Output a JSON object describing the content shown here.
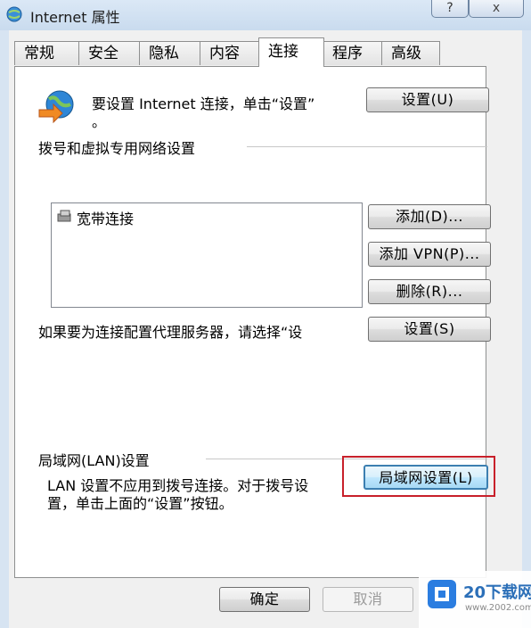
{
  "window": {
    "title": "Internet 属性",
    "help_btn": "?",
    "close_btn": "x"
  },
  "tabs": [
    {
      "label": "常规",
      "active": false
    },
    {
      "label": "安全",
      "active": false
    },
    {
      "label": "隐私",
      "active": false
    },
    {
      "label": "内容",
      "active": false
    },
    {
      "label": "连接",
      "active": true
    },
    {
      "label": "程序",
      "active": false
    },
    {
      "label": "高级",
      "active": false
    }
  ],
  "setup": {
    "text_line1": "要设置 Internet 连接，单击“设置”",
    "text_line2": "。",
    "button": "设置(U)"
  },
  "dialup": {
    "heading": "拨号和虚拟专用网络设置",
    "connections": [
      "宽带连接"
    ],
    "add_button": "添加(D)...",
    "add_vpn_button": "添加 VPN(P)...",
    "remove_button": "删除(R)...",
    "proxy_text": "如果要为连接配置代理服务器，请选择“设",
    "settings_button": "设置(S)"
  },
  "lan": {
    "heading": "局域网(LAN)设置",
    "text_line1": "LAN 设置不应用到拨号连接。对于拨号设",
    "text_line2": "置，单击上面的“设置”按钮。",
    "button": "局域网设置(L)"
  },
  "footer": {
    "ok_button": "确定",
    "cancel_button": "取消"
  },
  "watermark": {
    "logo": "20下载网",
    "url": "www.2002.com"
  },
  "colors": {
    "highlight_box": "#c8202a",
    "titlebar": "#c9dbee",
    "focus_border": "#3c7fb1"
  }
}
